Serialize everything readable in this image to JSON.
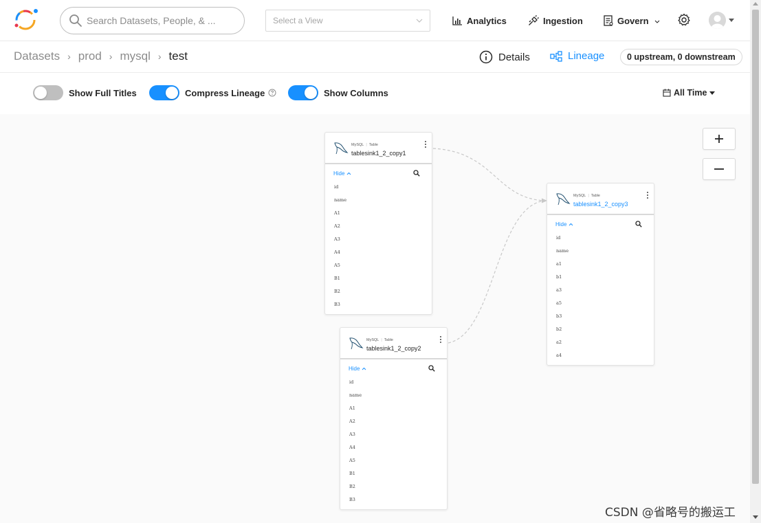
{
  "header": {
    "search_placeholder": "Search Datasets, People, & ...",
    "view_select_placeholder": "Select a View",
    "nav": {
      "analytics": "Analytics",
      "ingestion": "Ingestion",
      "govern": "Govern"
    }
  },
  "breadcrumb": {
    "items": [
      "Datasets",
      "prod",
      "mysql"
    ],
    "current": "test"
  },
  "tabs": {
    "details": "Details",
    "lineage": "Lineage",
    "lineage_count": "0 upstream, 0 downstream"
  },
  "toolbar": {
    "show_full_titles": {
      "label": "Show Full Titles",
      "on": false
    },
    "compress_lineage": {
      "label": "Compress Lineage",
      "on": true
    },
    "show_columns": {
      "label": "Show Columns",
      "on": true
    },
    "time_filter": "All Time"
  },
  "nodes": [
    {
      "platform": "MySQL",
      "subtype": "Table",
      "title": "tablesink1_2_copy1",
      "hide_label": "Hide",
      "columns": [
        "id",
        "name",
        "A1",
        "A2",
        "A3",
        "A4",
        "A5",
        "B1",
        "B2",
        "B3"
      ]
    },
    {
      "platform": "MySQL",
      "subtype": "Table",
      "title": "tablesink1_2_copy2",
      "hide_label": "Hide",
      "columns": [
        "id",
        "name",
        "A1",
        "A2",
        "A3",
        "A4",
        "A5",
        "B1",
        "B2",
        "B3"
      ]
    },
    {
      "platform": "MySQL",
      "subtype": "Table",
      "title": "tablesink1_2_copy3",
      "hide_label": "Hide",
      "columns": [
        "id",
        "name",
        "a1",
        "b1",
        "a3",
        "a5",
        "b3",
        "b2",
        "a2",
        "a4"
      ]
    }
  ],
  "footer_watermark": "CSDN @省略号的搬运工",
  "colors": {
    "accent": "#1890ff",
    "switch_off": "#bfbfbf",
    "edge": "#c8c8c8"
  },
  "icons": {
    "logo": "datahub-logo",
    "search": "search-icon",
    "analytics": "bar-chart-icon",
    "ingestion": "plug-icon",
    "govern": "file-text-icon",
    "settings": "gear-icon",
    "details": "info-circle-icon",
    "lineage": "partition-icon",
    "calendar": "calendar-icon",
    "zoom_in": "plus-icon",
    "zoom_out": "minus-icon"
  }
}
